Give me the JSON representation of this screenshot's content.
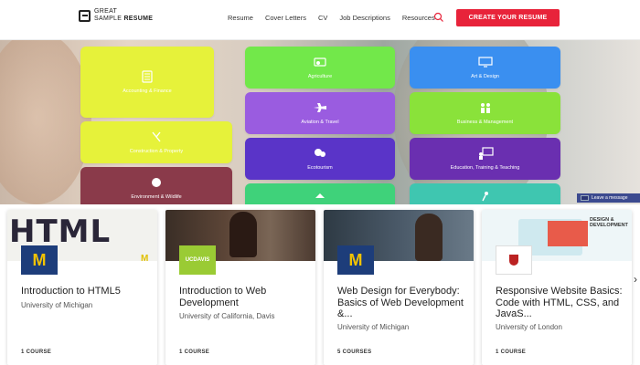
{
  "header": {
    "logo_line1": "GREAT",
    "logo_line2a": "SAMPLE",
    "logo_line2b": "RESUME",
    "nav": [
      "Resume",
      "Cover Letters",
      "CV",
      "Job Descriptions",
      "Resources"
    ],
    "cta": "CREATE YOUR RESUME",
    "accent": "#e8233a"
  },
  "tiles": [
    {
      "label": "Accounting & Finance",
      "color": "#e6f23a",
      "icon": "calculator-icon"
    },
    {
      "label": "Agriculture",
      "color": "#72e84a",
      "icon": "tractor-icon"
    },
    {
      "label": "Art & Design",
      "color": "#3a8ff0",
      "icon": "monitor-icon"
    },
    {
      "label": "Construction & Property",
      "color": "#e6f23a",
      "icon": "tools-icon"
    },
    {
      "label": "Aviation & Travel",
      "color": "#9a5ce0",
      "icon": "airplane-icon"
    },
    {
      "label": "Business & Management",
      "color": "#8ae23a",
      "icon": "people-icon"
    },
    {
      "label": "Environment & Wildlife",
      "color": "#8a3a4a",
      "icon": "globe-icon"
    },
    {
      "label": "Ecotourism",
      "color": "#5a34c8",
      "icon": "leaf-icon"
    },
    {
      "label": "Education, Training & Teaching",
      "color": "#6a2fb0",
      "icon": "board-icon"
    },
    {
      "label": "",
      "color": "#3fd27a",
      "icon": "more-icon"
    },
    {
      "label": "",
      "color": "#3fc6b0",
      "icon": "runner-icon"
    }
  ],
  "chat_badge": "Leave a message",
  "courses": [
    {
      "title": "Introduction to HTML5",
      "org": "University of Michigan",
      "count": "1 COURSE",
      "thumb_text": "HTML"
    },
    {
      "title": "Introduction to Web Development",
      "org": "University of California, Davis",
      "count": "1 COURSE",
      "logo_text": "UCDAVIS"
    },
    {
      "title": "Web Design for Everybody: Basics of Web Development &...",
      "org": "University of Michigan",
      "count": "5 COURSES"
    },
    {
      "title": "Responsive Website Basics: Code with HTML, CSS, and JavaS...",
      "org": "University of London",
      "count": "1 COURSE",
      "thumb_text": "DESIGN & DEVELOPMENT"
    }
  ]
}
